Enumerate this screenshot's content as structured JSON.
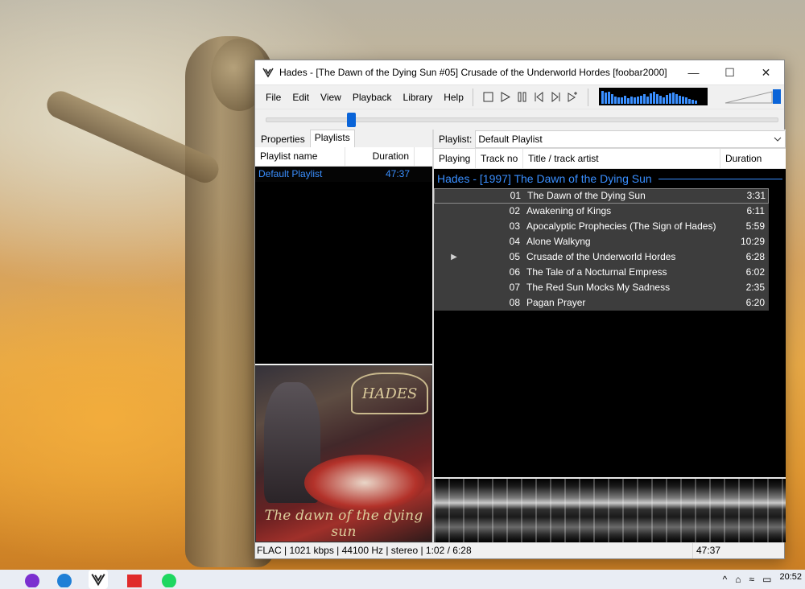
{
  "window": {
    "title": "Hades - [The Dawn of the Dying Sun #05] Crusade of the Underworld Hordes  [foobar2000]",
    "minimize": "—",
    "maximize": "☐",
    "close": "✕"
  },
  "menu": [
    "File",
    "Edit",
    "View",
    "Playback",
    "Library",
    "Help"
  ],
  "seek": {
    "position_fraction": 0.16
  },
  "volume": {
    "level_fraction": 0.98
  },
  "visualizer": {
    "bars": [
      16,
      14,
      15,
      12,
      9,
      8,
      8,
      10,
      7,
      9,
      8,
      9,
      10,
      12,
      9,
      13,
      15,
      12,
      10,
      8,
      11,
      13,
      14,
      12,
      10,
      9,
      8,
      6,
      5,
      4
    ]
  },
  "left_panel": {
    "tabs": [
      "Properties",
      "Playlists"
    ],
    "active_tab": "Playlists",
    "columns": [
      "Playlist name",
      "Duration"
    ],
    "playlists": [
      {
        "name": "Default Playlist",
        "duration": "47:37"
      }
    ],
    "album_art_caption": "The dawn of the dying sun",
    "album_art_logo": "HADES"
  },
  "playlist_view": {
    "switcher_label": "Playlist:",
    "selected_playlist": "Default Playlist",
    "columns": [
      "Playing",
      "Track no",
      "Title / track artist",
      "Duration"
    ],
    "group_header": "Hades - [1997] The Dawn of the Dying Sun",
    "tracks": [
      {
        "playing": "",
        "no": "01",
        "title": "The Dawn of the Dying Sun",
        "duration": "3:31"
      },
      {
        "playing": "",
        "no": "02",
        "title": "Awakening of Kings",
        "duration": "6:11"
      },
      {
        "playing": "",
        "no": "03",
        "title": "Apocalyptic Prophecies (The Sign of Hades)",
        "duration": "5:59"
      },
      {
        "playing": "",
        "no": "04",
        "title": "Alone Walkyng",
        "duration": "10:29"
      },
      {
        "playing": "▶",
        "no": "05",
        "title": "Crusade of the Underworld Hordes",
        "duration": "6:28"
      },
      {
        "playing": "",
        "no": "06",
        "title": "The Tale of a Nocturnal Empress",
        "duration": "6:02"
      },
      {
        "playing": "",
        "no": "07",
        "title": "The Red Sun Mocks My Sadness",
        "duration": "2:35"
      },
      {
        "playing": "",
        "no": "08",
        "title": "Pagan Prayer",
        "duration": "6:20"
      }
    ]
  },
  "status": {
    "info": "FLAC | 1021 kbps | 44100 Hz | stereo | 1:02 / 6:28",
    "total": "47:37"
  },
  "taskbar": {
    "clock": "20:52",
    "colors": {
      "accent": "#3a8fff",
      "panel_bg": "#000000",
      "track_bg": "#3d3d3d"
    }
  }
}
